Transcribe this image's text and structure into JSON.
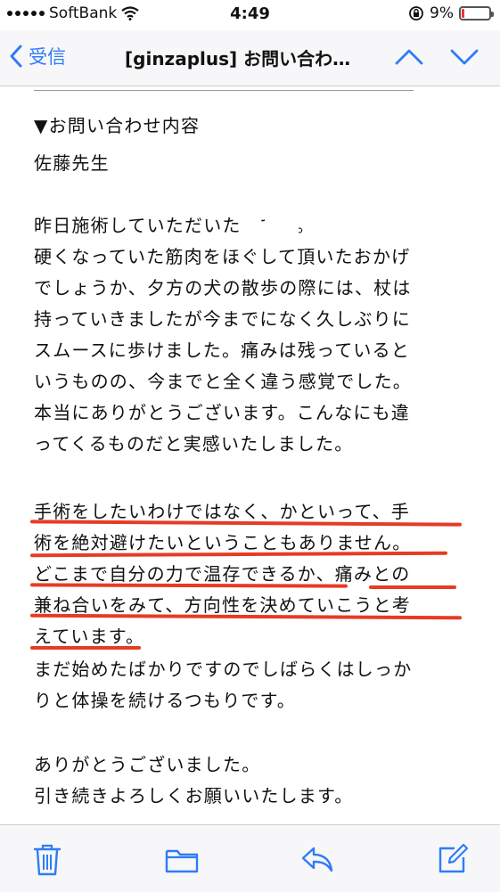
{
  "status": {
    "carrier": "SoftBank",
    "time": "4:49",
    "battery": "9%",
    "battery_level": 0.09
  },
  "nav": {
    "back_label": "受信",
    "title": "[ginzaplus] お問い合わ…"
  },
  "email": {
    "heading": "▼お問い合わせ内容",
    "greeting": "佐藤先生",
    "lines": [
      "昨日施術していただいた　です。",
      "硬くなっていた筋肉をほぐして頂いたおかげ",
      "でしょうか、夕方の犬の散歩の際には、杖は",
      "持っていきましたが今までになく久しぶりに",
      "スムースに歩けました。痛みは残っていると",
      "いうものの、今までと全く違う感覚でした。",
      "本当にありがとうございます。こんなにも違",
      "ってくるものだと実感いたしました。",
      "手術をしたいわけではなく、かといって、手",
      "術を絶対避けたいということもありません。",
      "どこまで自分の力で温存できるか、痛みとの",
      "兼ね合いをみて、方向性を決めていこうと考",
      "えています。",
      "まだ始めたばかりですのでしばらくはしっか",
      "りと体操を続けるつもりです。",
      "ありがとうございました。",
      "引き続きよろしくお願いいたします。"
    ],
    "underline_color": "#e63b25"
  },
  "colors": {
    "accent": "#2f7cf6",
    "underline": "#e63b25"
  },
  "toolbar": {
    "icons": [
      "trash-icon",
      "folder-icon",
      "reply-icon",
      "compose-icon"
    ]
  }
}
